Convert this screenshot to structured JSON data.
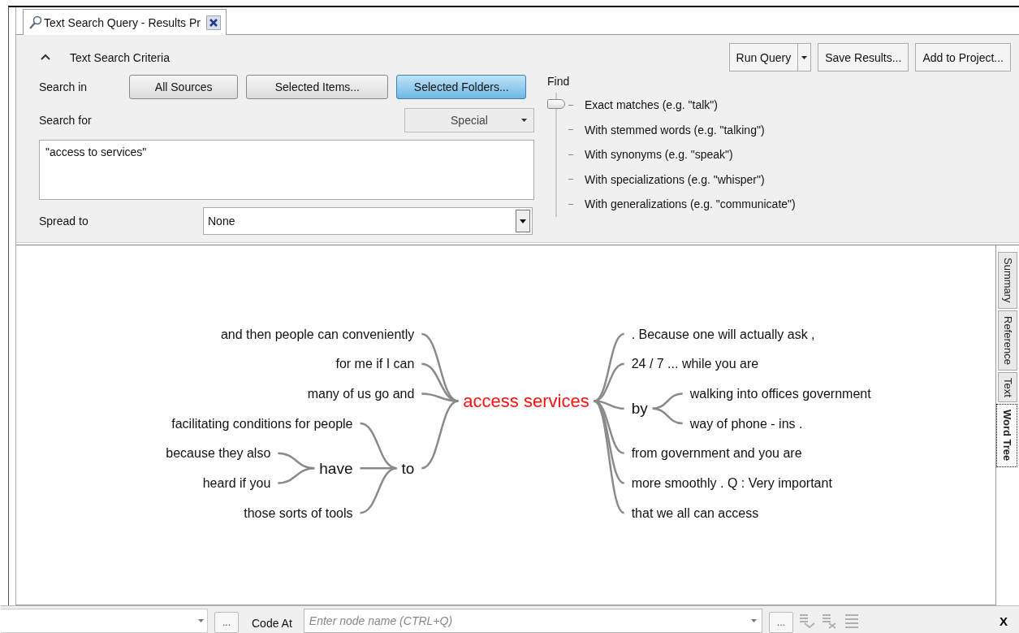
{
  "tab": {
    "title": "Text Search Query - Results Pr",
    "selected": true
  },
  "criteria": {
    "title": "Text Search Criteria",
    "expanded": true
  },
  "actions": [
    {
      "label": "Run Query",
      "kind": "split"
    },
    {
      "label": "Save Results...",
      "kind": "button"
    },
    {
      "label": "Add to Project...",
      "kind": "button"
    }
  ],
  "search_in": {
    "label": "Search in",
    "options": [
      {
        "label": "All Sources",
        "selected": false
      },
      {
        "label": "Selected Items...",
        "selected": false
      },
      {
        "label": "Selected Folders...",
        "selected": true
      }
    ]
  },
  "search_for": {
    "label": "Search for",
    "special": "Special",
    "value": "\"access to services\""
  },
  "spread_to": {
    "label": "Spread to",
    "value": "None"
  },
  "find": {
    "label": "Find",
    "options": [
      {
        "label": "Exact matches (e.g. \"talk\")",
        "selected": true
      },
      {
        "label": "With stemmed words (e.g. \"talking\")",
        "selected": false
      },
      {
        "label": "With synonyms (e.g. \"speak\")",
        "selected": false
      },
      {
        "label": "With specializations (e.g. \"whisper\")",
        "selected": false
      },
      {
        "label": "With generalizations (e.g. \"communicate\")",
        "selected": false
      }
    ]
  },
  "word_tree": {
    "root": "access services",
    "left": [
      {
        "text": "and then people can conveniently"
      },
      {
        "text": "for me if I can"
      },
      {
        "text": "many of us go and"
      },
      {
        "text": "to",
        "children": [
          {
            "text": "facilitating conditions for people"
          },
          {
            "text": "have",
            "children": [
              {
                "text": "because they also"
              },
              {
                "text": "heard if you"
              }
            ]
          },
          {
            "text": "those sorts of tools"
          }
        ]
      }
    ],
    "right": [
      {
        "text": ". Because one will actually ask ,"
      },
      {
        "text": "24 / 7 ... while you are"
      },
      {
        "text": "by",
        "children": [
          {
            "text": "walking into offices government"
          },
          {
            "text": "way of phone - ins ."
          }
        ]
      },
      {
        "text": "from government and you are"
      },
      {
        "text": "more smoothly . Q : Very important"
      },
      {
        "text": "that we all can access"
      }
    ]
  },
  "side_tabs": [
    {
      "label": "Summary",
      "selected": false
    },
    {
      "label": "Reference",
      "selected": false
    },
    {
      "label": "Text",
      "selected": false
    },
    {
      "label": "Word Tree",
      "selected": true
    }
  ],
  "bottom_bar": {
    "browse_left": "...",
    "code_at": "Code At",
    "node_placeholder": "Enter node name (CTRL+Q)",
    "browse_right": "...",
    "close": "X"
  }
}
